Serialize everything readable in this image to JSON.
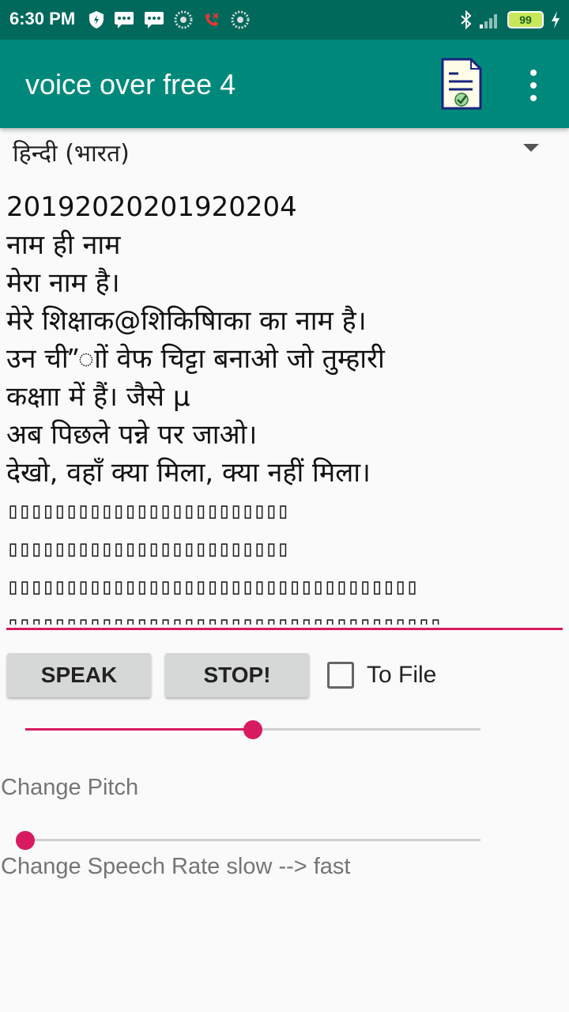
{
  "status_bar": {
    "time": "6:30 PM",
    "battery": "99"
  },
  "app_bar": {
    "title": "voice over free 4",
    "doc_icon": "document-check-icon",
    "menu_icon": "more-vert-icon"
  },
  "language_spinner": {
    "selected": "हिन्दी (भारत)"
  },
  "text_input": {
    "lines": [
      "20192020201920204",
      "नाम ही नाम",
      "मेरा नाम  है।",
      "मेरे शिक्षाक@शिकिषिाका का नाम  है।",
      "उन ची”ाों वेफ चिट्टा बनाओ जो तुम्हारी",
      "कक्षाा में हैं। जैसे µ",
      "अब पिछले पन्ने पर जाओ।",
      "देखो, वहाँ क्या मिला, क्या नहीं मिला।",
      "▯▯▯▯▯▯▯▯▯▯▯▯▯▯▯▯▯▯▯▯▯▯▯▯",
      "▯▯▯▯▯▯▯▯▯▯▯▯▯▯▯▯▯▯▯▯▯▯▯▯",
      "▯▯▯▯▯▯▯▯▯▯▯▯▯▯▯▯▯▯▯▯▯▯▯▯▯▯▯▯▯▯▯▯▯▯▯",
      "▯▯▯▯▯▯▯▯▯▯▯▯▯▯▯▯▯▯▯▯▯▯▯▯▯▯▯▯▯▯▯▯▯▯▯▯▯"
    ]
  },
  "controls": {
    "speak_label": "SPEAK",
    "stop_label": "STOP!",
    "to_file_label": "To File",
    "to_file_checked": false
  },
  "pitch": {
    "label": "Change Pitch",
    "value_fraction": 0.5
  },
  "rate": {
    "label": "Change Speech Rate slow --> fast",
    "value_fraction": 0.0
  },
  "colors": {
    "status_bar": "#00695c",
    "app_bar": "#00897b",
    "accent": "#d81b60"
  }
}
